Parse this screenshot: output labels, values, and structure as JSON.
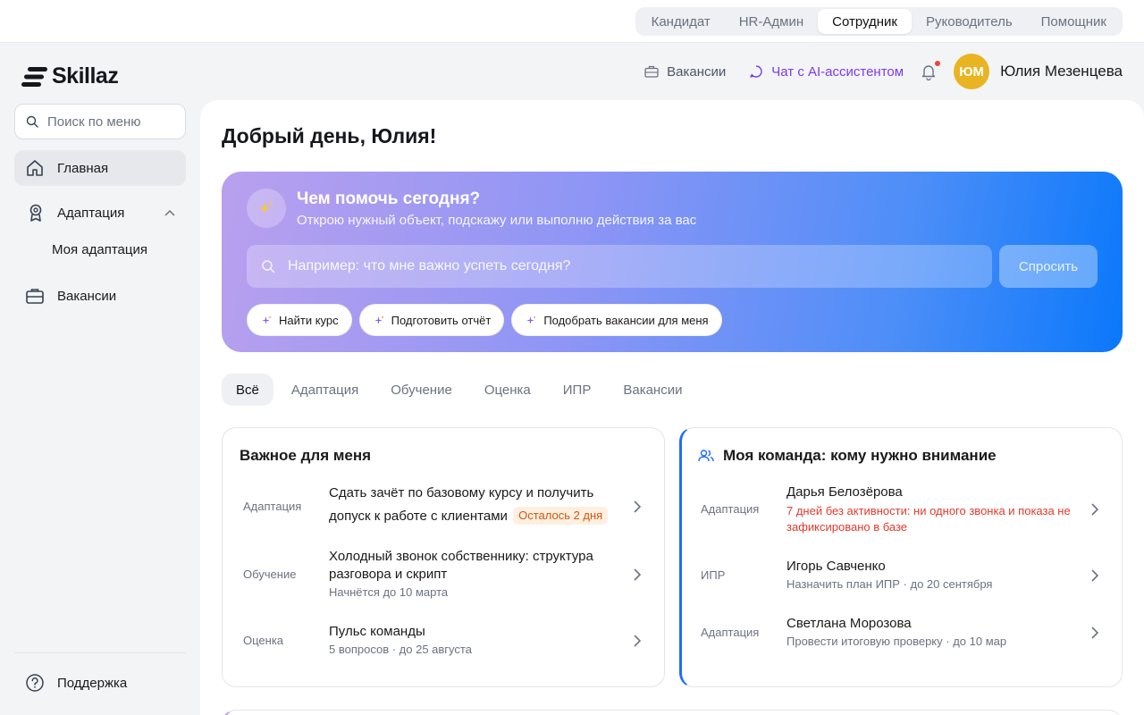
{
  "roles": [
    "Кандидат",
    "HR-Админ",
    "Сотрудник",
    "Руководитель",
    "Помощник"
  ],
  "active_role": "Сотрудник",
  "logo": {
    "text": "Skillaz"
  },
  "sidebar": {
    "search_placeholder": "Поиск по меню",
    "items": [
      {
        "label": "Главная",
        "icon": "home-icon",
        "active": true
      },
      {
        "label": "Адаптация",
        "icon": "badge-icon",
        "expanded": true
      },
      {
        "label": "Моя адаптация",
        "sub": true
      },
      {
        "label": "Вакансии",
        "icon": "briefcase-icon"
      }
    ],
    "support": "Поддержка"
  },
  "header": {
    "vacancies": "Вакансии",
    "ai_chat": "Чат с AI-ассистентом",
    "avatar_initials": "ЮМ",
    "user_name": "Юлия Мезенцева"
  },
  "main": {
    "greeting": "Добрый день, Юлия!",
    "hero": {
      "title": "Чем помочь сегодня?",
      "subtitle": "Открою нужный объект, подскажу или выполню действия за вас",
      "input_placeholder": "Например: что мне важно успеть сегодня?",
      "ask_label": "Спросить",
      "chips": [
        "Найти курс",
        "Подготовить отчёт",
        "Подобрать вакансии для меня"
      ]
    },
    "tabs": [
      "Всё",
      "Адаптация",
      "Обучение",
      "Оценка",
      "ИПР",
      "Вакансии"
    ],
    "important": {
      "title": "Важное для меня",
      "rows": [
        {
          "category": "Адаптация",
          "title": "Сдать зачёт по базовому курсу и получить допуск к работе с клиентами",
          "badge": "Осталось 2 дня"
        },
        {
          "category": "Обучение",
          "title": "Холодный звонок собственнику: структура разговора и скрипт",
          "meta": "Начнётся до 10 марта"
        },
        {
          "category": "Оценка",
          "title": "Пульс команды",
          "meta": "5 вопросов · до 25 августа"
        }
      ]
    },
    "team": {
      "title": "Моя команда: кому нужно внимание",
      "rows": [
        {
          "category": "Адаптация",
          "name": "Дарья Белозёрова",
          "alert": "7 дней без активности: ни одного звонка и показа не зафиксировано в базе"
        },
        {
          "category": "ИПР",
          "name": "Игорь Савченко",
          "meta": "Назначить план ИПР · до 20 сентября"
        },
        {
          "category": "Адаптация",
          "name": "Светлана Морозова",
          "meta": "Провести итоговую проверку · до 10 мар"
        }
      ]
    }
  },
  "colors": {
    "accent": "#1f6dfb",
    "ai": "#7c3aed",
    "alert": "#e5392b",
    "badge_bg": "#fdf0e1",
    "badge_text": "#d1560c",
    "avatar": "#e8b422"
  }
}
